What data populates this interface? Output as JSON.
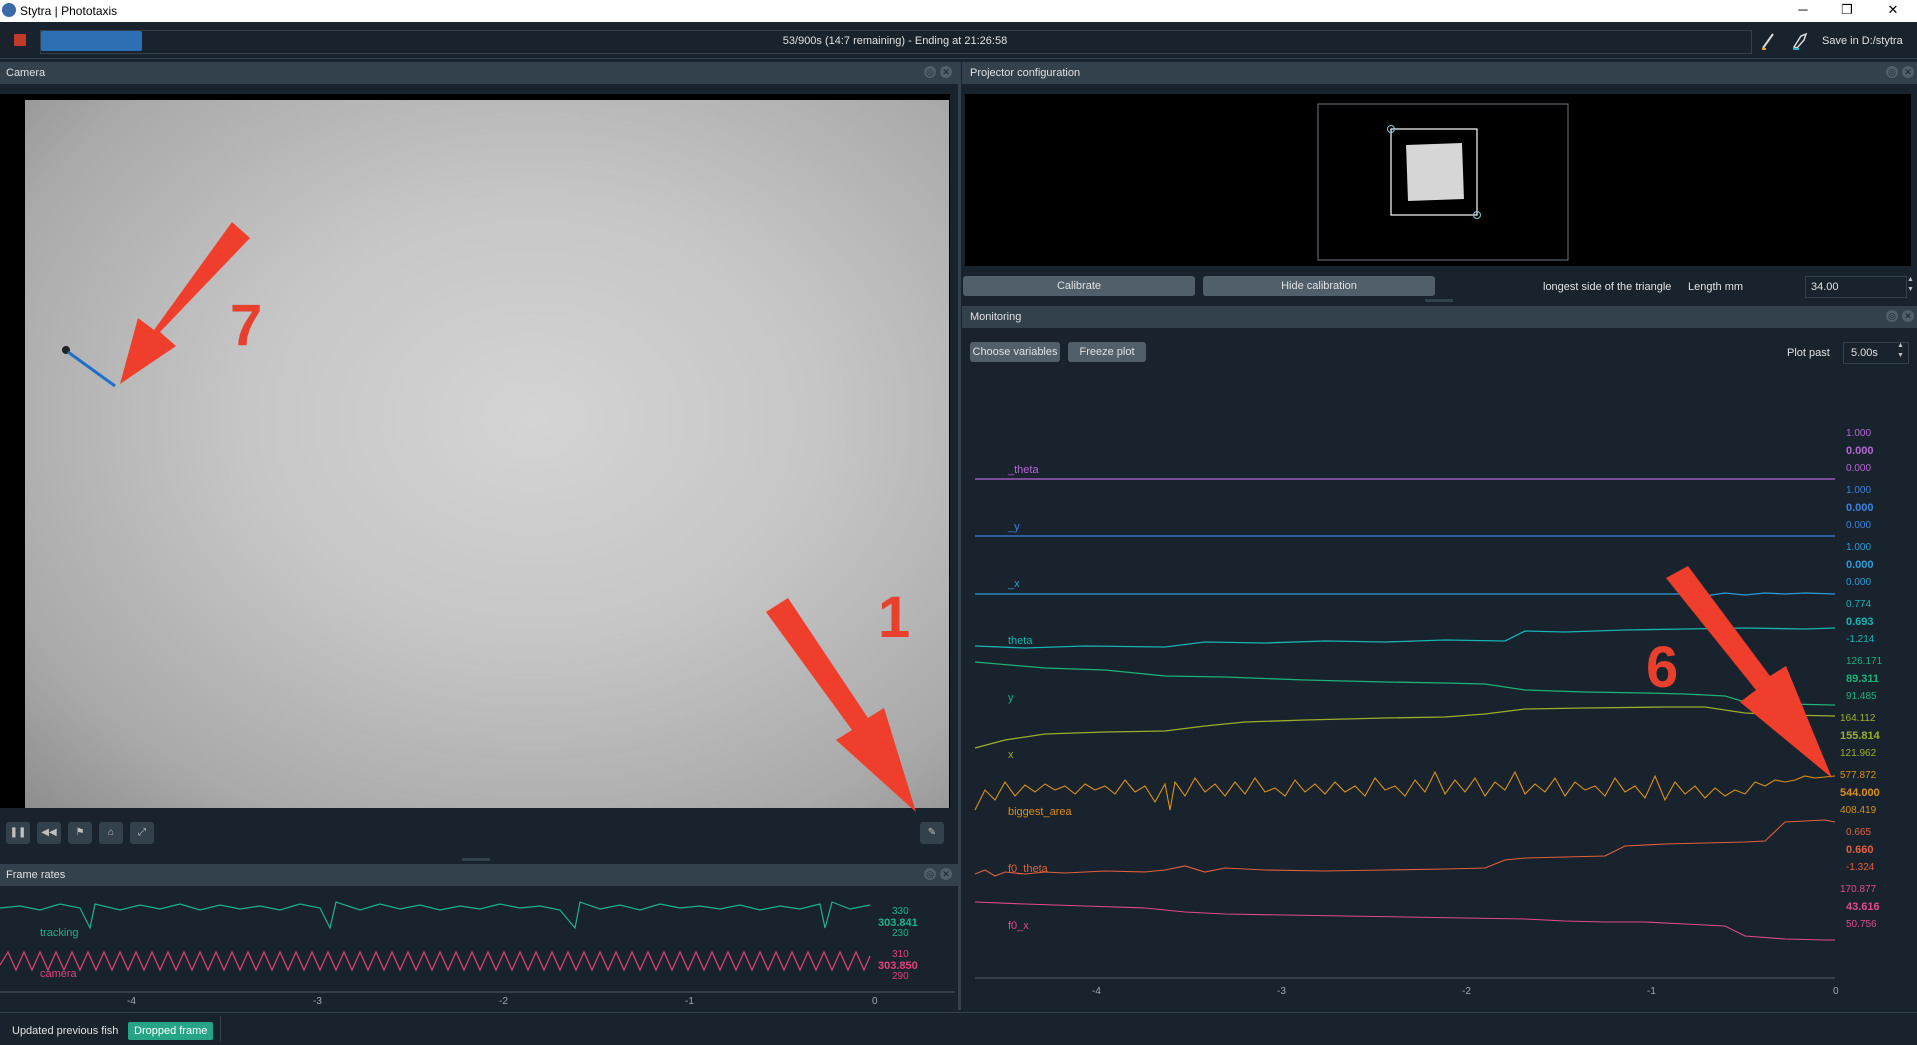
{
  "window": {
    "title": "Stytra | Phototaxis",
    "min": "─",
    "restore": "❐",
    "close": "✕"
  },
  "toolbar": {
    "progress_text": "53/900s (14:7 remaining) - Ending at 21:26:58",
    "progress_fraction": 0.0589,
    "save_location": "Save in D:/stytra"
  },
  "camera": {
    "panel_title": "Camera",
    "controls": [
      "pause",
      "rewind",
      "tracking-overlay",
      "snapshot",
      "roi"
    ],
    "icons": {
      "pause": "❚❚",
      "rewind": "◀◀",
      "tracking-overlay": "⚑",
      "snapshot": "⌂",
      "roi": "⤢",
      "record": "✎"
    }
  },
  "frame_rates": {
    "panel_title": "Frame rates",
    "series": [
      {
        "name": "tracking",
        "max": "330",
        "current": "303.841",
        "min": "230",
        "color": "#1fb28a"
      },
      {
        "name": "camera",
        "max": "310",
        "current": "303.850",
        "min": "290",
        "color": "#e0427a"
      }
    ],
    "x_ticks": [
      "-4",
      "-3",
      "-2",
      "-1",
      "0"
    ]
  },
  "projector": {
    "panel_title": "Projector configuration",
    "calibrate_label": "Calibrate",
    "hide_calibration_label": "Hide calibration",
    "triangle_label": "longest side of the triangle",
    "length_label": "Length mm",
    "length_value": "34.00"
  },
  "monitoring": {
    "panel_title": "Monitoring",
    "choose_variables_label": "Choose variables",
    "freeze_plot_label": "Freeze plot",
    "plot_past_label": "Plot past",
    "plot_past_value": "5.00s",
    "x_ticks": [
      "-4",
      "-3",
      "-2",
      "-1",
      "0"
    ],
    "traces": [
      {
        "name": "_theta",
        "max": "1.000",
        "current": "0.000",
        "min": "0.000",
        "color": "#b565d6"
      },
      {
        "name": "_y",
        "max": "1.000",
        "current": "0.000",
        "min": "0.000",
        "color": "#3b82e0"
      },
      {
        "name": "_x",
        "max": "1.000",
        "current": "0.000",
        "min": "0.000",
        "color": "#2d9ad8"
      },
      {
        "name": "theta",
        "max": "0.774",
        "current": "0.693",
        "min": "-1.214",
        "color": "#17b3b3"
      },
      {
        "name": "y",
        "max": "126.171",
        "current": "89.311",
        "min": "91.485",
        "color": "#1fb07a"
      },
      {
        "name": "x",
        "max": "164.112",
        "current": "155.814",
        "min": "121.962",
        "color": "#9aae2c"
      },
      {
        "name": "biggest_area",
        "max": "577.872",
        "current": "544.000",
        "min": "408.419",
        "color": "#d98f1a"
      },
      {
        "name": "f0_theta",
        "max": "0.665",
        "current": "0.660",
        "min": "-1.324",
        "color": "#e2603f"
      },
      {
        "name": "f0_x",
        "max": "170.877",
        "current": "43.616",
        "min": "50.756",
        "color": "#e04a8e"
      }
    ]
  },
  "annotations": {
    "labels": [
      "7",
      "1",
      "6"
    ],
    "color": "#ef3e2c"
  },
  "statusbar": {
    "message": "Updated previous fish",
    "badge": "Dropped frame"
  }
}
